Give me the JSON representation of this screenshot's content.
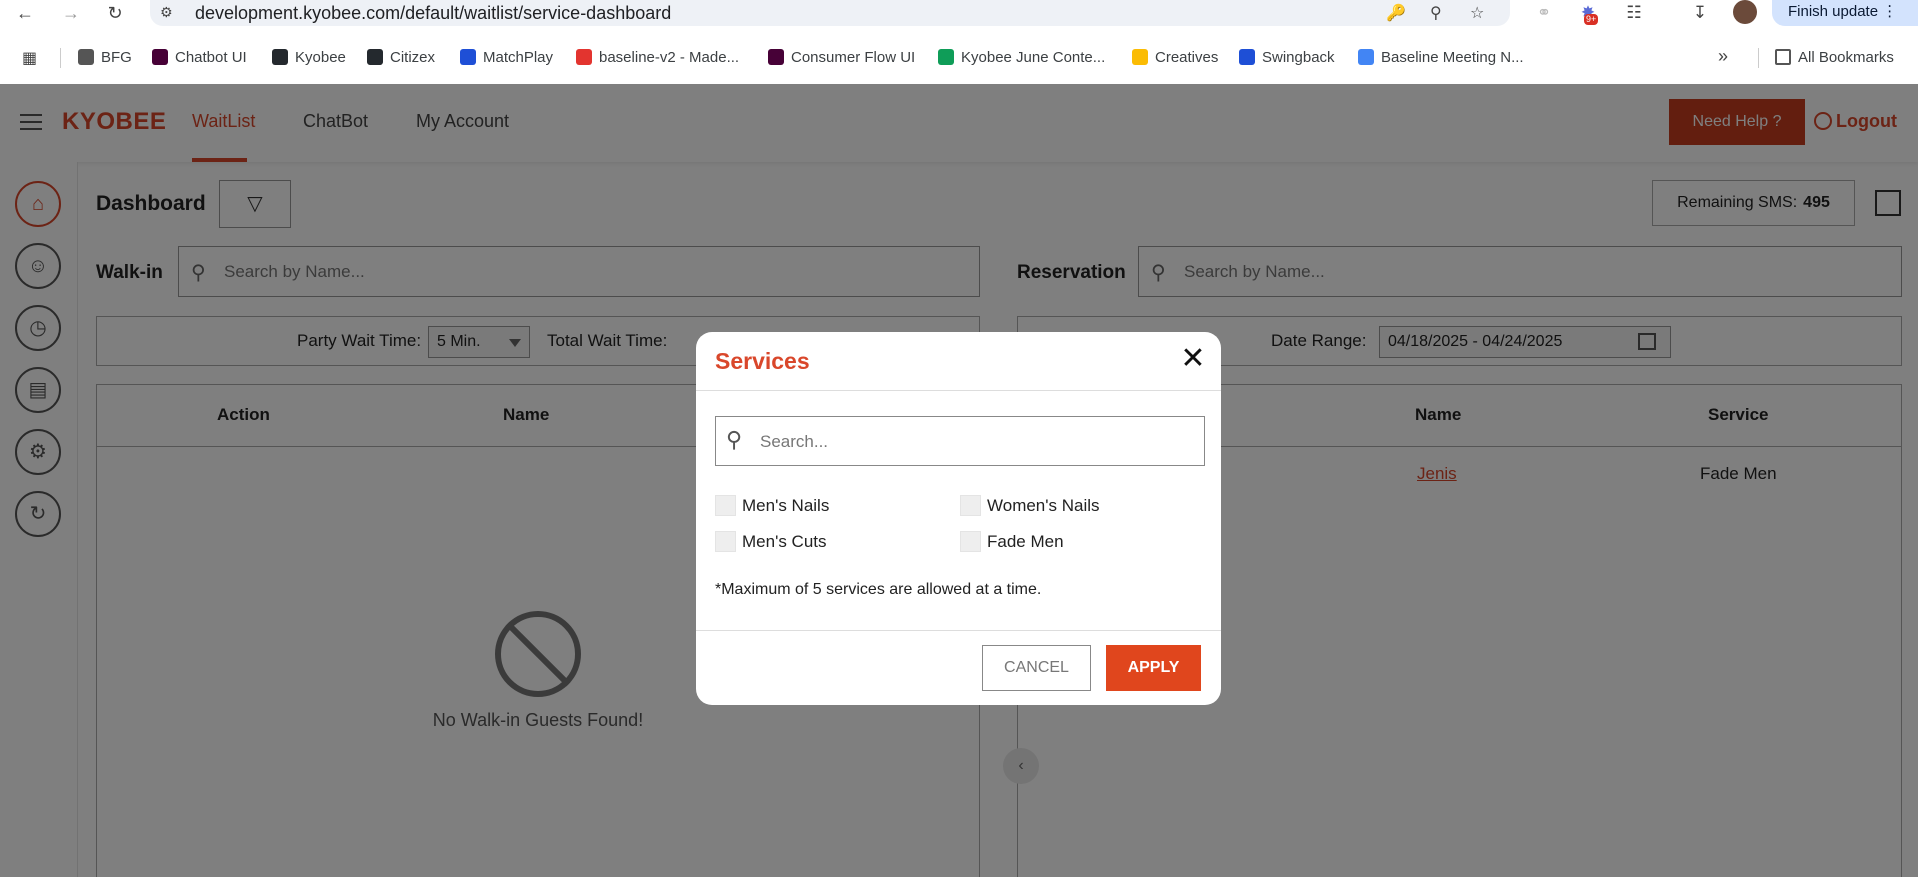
{
  "browser": {
    "url": "development.kyobee.com/default/waitlist/service-dashboard",
    "finish_update": "Finish update",
    "notification_badge": "9+",
    "bookmarks": [
      {
        "label": "BFG",
        "color": "#555555"
      },
      {
        "label": "Chatbot UI",
        "color": "#470137"
      },
      {
        "label": "Kyobee",
        "color": "#24292e"
      },
      {
        "label": "Citizex",
        "color": "#24292e"
      },
      {
        "label": "MatchPlay",
        "color": "#1e4fd6"
      },
      {
        "label": "baseline-v2 - Made...",
        "color": "#e3342f"
      },
      {
        "label": "Consumer Flow UI",
        "color": "#470137"
      },
      {
        "label": "Kyobee June Conte...",
        "color": "#0f9d58"
      },
      {
        "label": "Creatives",
        "color": "#fbbc04"
      },
      {
        "label": "Swingback",
        "color": "#1e4fd6"
      },
      {
        "label": "Baseline Meeting N...",
        "color": "#4285f4"
      }
    ],
    "all_bookmarks": "All Bookmarks"
  },
  "app": {
    "logo": "KYOBEE",
    "nav": [
      "WaitList",
      "ChatBot",
      "My Account"
    ],
    "help": "Need Help ?",
    "logout": "Logout",
    "accent": "#d9472b"
  },
  "dashboard": {
    "title": "Dashboard",
    "remaining_sms_label": "Remaining SMS:",
    "remaining_sms_value": "495",
    "walkin": {
      "label": "Walk-in",
      "search_placeholder": "Search by Name...",
      "party_wait_label": "Party Wait Time:",
      "party_wait_value": "5 Min.",
      "total_wait_label": "Total Wait Time:",
      "col_action": "Action",
      "col_name": "Name",
      "empty": "No Walk-in Guests Found!"
    },
    "reservation": {
      "label": "Reservation",
      "search_placeholder": "Search by Name...",
      "date_range_label": "Date Range:",
      "date_range_value": "04/18/2025 - 04/24/2025",
      "col_name": "Name",
      "col_service": "Service",
      "row_name": "Jenis",
      "row_service": "Fade Men"
    }
  },
  "modal": {
    "title": "Services",
    "search_placeholder": "Search...",
    "options": [
      "Men's Nails",
      "Women's Nails",
      "Men's Cuts",
      "Fade Men"
    ],
    "note": "*Maximum of 5 services are allowed at a time.",
    "cancel": "CANCEL",
    "apply": "APPLY"
  }
}
